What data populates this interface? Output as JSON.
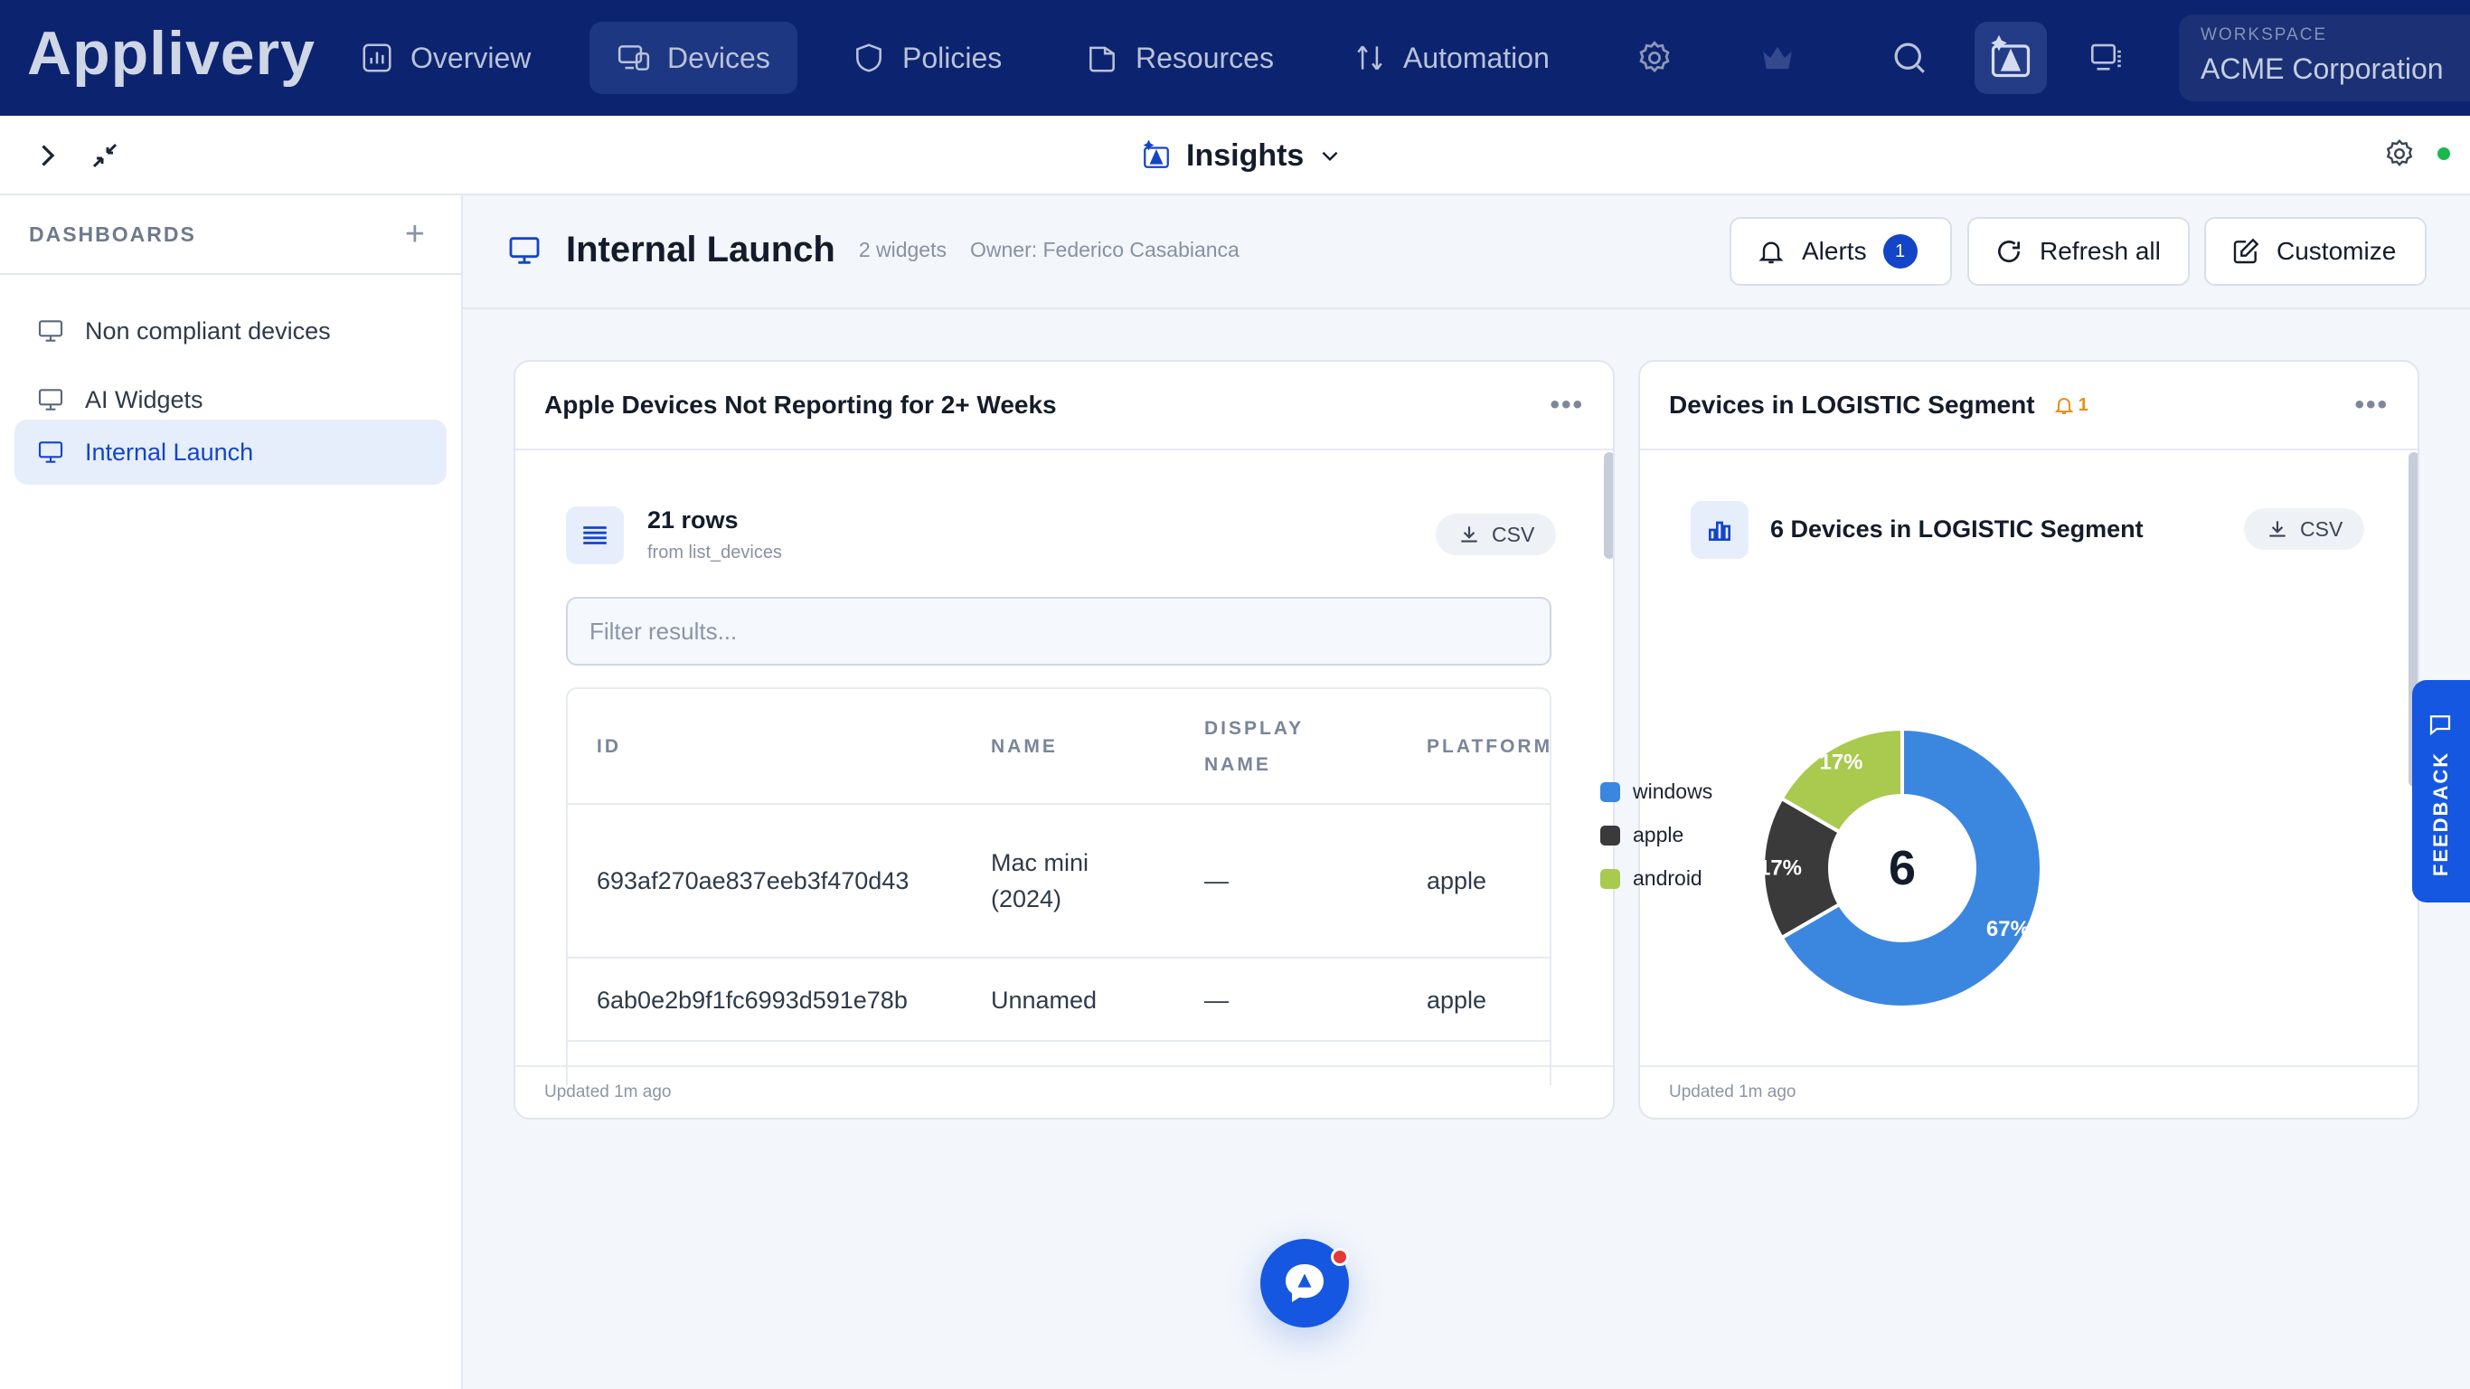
{
  "brand": {
    "logo": "Applivery"
  },
  "nav": {
    "items": [
      {
        "id": "overview",
        "label": "Overview"
      },
      {
        "id": "devices",
        "label": "Devices"
      },
      {
        "id": "policies",
        "label": "Policies"
      },
      {
        "id": "resources",
        "label": "Resources"
      },
      {
        "id": "automation",
        "label": "Automation"
      }
    ],
    "active": "devices",
    "workspace_label": "WORKSPACE",
    "workspace_name": "ACME Corporation"
  },
  "subbar": {
    "title": "Insights"
  },
  "sidebar": {
    "heading": "DASHBOARDS",
    "items": [
      {
        "label": "Non compliant devices"
      },
      {
        "label": "AI Widgets"
      },
      {
        "label": "Internal Launch"
      }
    ],
    "active_index": 2
  },
  "dashboard": {
    "title": "Internal Launch",
    "widgets_count": "2 widgets",
    "owner": "Owner: Federico Casabianca",
    "alerts_label": "Alerts",
    "alerts_count": "1",
    "refresh_label": "Refresh all",
    "customize_label": "Customize"
  },
  "widget_table": {
    "title": "Apple Devices Not Reporting for 2+ Weeks",
    "rows_count": "21 rows",
    "source": "from list_devices",
    "csv_label": "CSV",
    "filter_placeholder": "Filter results...",
    "columns": [
      "ID",
      "NAME",
      "DISPLAY",
      "NAME",
      "PLATFORM"
    ],
    "rows": [
      {
        "id": "693af270ae837eeb3f470d43",
        "name_line1": "Mac mini",
        "name_line2": "(2024)",
        "display": "—",
        "platform": "apple"
      },
      {
        "id": "6ab0e2b9f1fc6993d591e78b",
        "name_line1": "Unnamed",
        "name_line2": "",
        "display": "—",
        "platform": "apple"
      }
    ],
    "updated": "Updated 1m ago"
  },
  "widget_chart": {
    "title": "Devices in LOGISTIC Segment",
    "alert_count": "1",
    "subtitle": "6 Devices in LOGISTIC Segment",
    "csv_label": "CSV",
    "updated": "Updated 1m ago"
  },
  "chart_data": {
    "type": "pie",
    "center_label": "6",
    "categories": [
      "windows",
      "apple",
      "android"
    ],
    "values": [
      4,
      1,
      1
    ],
    "percent_labels": [
      "67%",
      "17%",
      "17%"
    ],
    "colors": [
      "#3b87e0",
      "#3a3a3a",
      "#a9c94f"
    ],
    "legend_position": "right"
  },
  "feedback": {
    "label": "FEEDBACK"
  }
}
